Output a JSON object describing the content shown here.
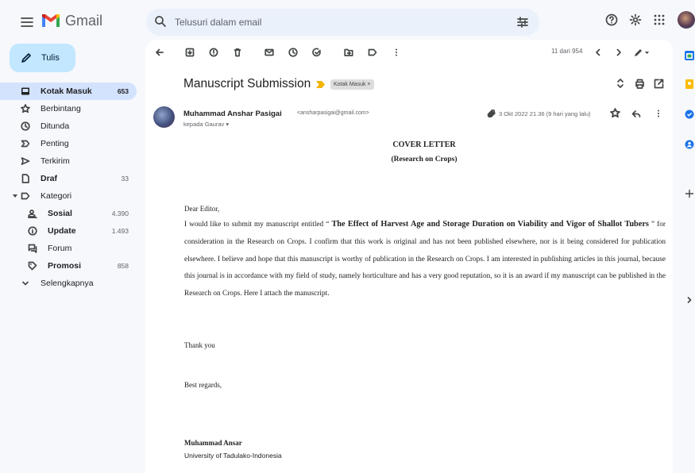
{
  "app": {
    "brand": "Gmail"
  },
  "search": {
    "placeholder": "Telusuri dalam email"
  },
  "compose": {
    "label": "Tulis"
  },
  "sidebar": {
    "items": [
      {
        "label": "Kotak Masuk",
        "count": "653"
      },
      {
        "label": "Berbintang",
        "count": ""
      },
      {
        "label": "Ditunda",
        "count": ""
      },
      {
        "label": "Penting",
        "count": ""
      },
      {
        "label": "Terkirim",
        "count": ""
      },
      {
        "label": "Draf",
        "count": "33"
      },
      {
        "label": "Kategori",
        "count": ""
      },
      {
        "label": "Sosial",
        "count": "4.390"
      },
      {
        "label": "Update",
        "count": "1.493"
      },
      {
        "label": "Forum",
        "count": ""
      },
      {
        "label": "Promosi",
        "count": "858"
      },
      {
        "label": "Selengkapnya",
        "count": ""
      }
    ]
  },
  "toolbar": {
    "pager": "11 dari 954"
  },
  "email": {
    "subject": "Manuscript Submission",
    "label_chip": "Kotak Masuk ×",
    "sender_name": "Muhammad Anshar Pasigai",
    "sender_email": "<ansharpasigai@gmail.com>",
    "recipient": "kepada Gaurav ▾",
    "date": "3 Okt 2022 21.36 (9 hari yang lalu)"
  },
  "letter": {
    "title": "COVER LETTER",
    "subtitle": "(Research on Crops)",
    "salutation": "Dear Editor,",
    "body_pre": "I would like to submit my manuscript entitled “ ",
    "manuscript_title": "The Effect of Harvest Age and Storage Duration on Viability and Vigor of Shallot Tubers",
    "body_post": " ” for consideration in the Research on Crops. I confirm that this work is original and has not been published elsewhere, nor is it being considered for publication elsewhere. I believe and hope that this manuscript is worthy of publication in the Research on Crops. I am interested in publishing articles in this journal, because this journal is in accordance with my field of study, namely horticulture and has a very good reputation, so it is an award if my manuscript can be published in the Research on Crops. Here I attach the manuscript.",
    "thanks": "Thank you",
    "regards": "Best regards,",
    "signature_name": "Muhammad Ansar",
    "signature_affiliation": "University of Tadulako-Indonesia"
  },
  "colors": {
    "compose_bg": "#c2e7ff",
    "active_nav": "#d3e3fd",
    "search_bg": "#eaf1fb",
    "page_bg": "#f6f8fc",
    "label_arrow": "#f4b400"
  }
}
